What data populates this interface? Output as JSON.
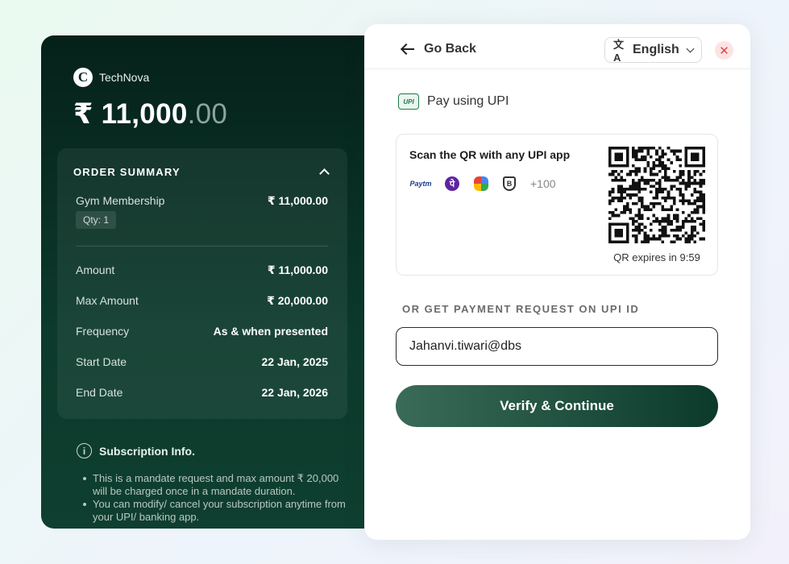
{
  "merchant": {
    "logo_letter": "C",
    "name": "TechNova"
  },
  "total": {
    "main": "₹ 11,000",
    "decimals": ".00"
  },
  "order_summary": {
    "title": "ORDER SUMMARY",
    "item": {
      "name": "Gym Membership",
      "price": "₹ 11,000.00",
      "qty": "Qty: 1"
    },
    "details": [
      {
        "label": "Amount",
        "value": "₹ 11,000.00"
      },
      {
        "label": "Max Amount",
        "value": "₹ 20,000.00"
      },
      {
        "label": "Frequency",
        "value": "As & when presented"
      },
      {
        "label": "Start Date",
        "value": "22 Jan, 2025"
      },
      {
        "label": "End Date",
        "value": "22 Jan, 2026"
      }
    ]
  },
  "subscription_info": {
    "icon": "info-icon",
    "title": "Subscription Info.",
    "bullets": [
      "This is a mandate request and max amount ₹ 20,000 will be charged once in a mandate duration.",
      "You can modify/ cancel your subscription anytime from your UPI/ banking app."
    ]
  },
  "topbar": {
    "back_label": "Go Back",
    "language": {
      "icon": "文A",
      "label": "English"
    },
    "close_symbol": "✕"
  },
  "upi": {
    "icon_text": "UPI",
    "title": "Pay using UPI",
    "scan_text": "Scan the QR with any UPI app",
    "apps": {
      "paytm": "Paytm",
      "phonepe": "पे",
      "bhim": "B",
      "more": "+100"
    },
    "qr_expiry": "QR expires in 9:59",
    "or_label": "OR GET PAYMENT REQUEST ON UPI ID",
    "input_value": "Jahanvi.tiwari@dbs",
    "verify_label": "Verify & Continue"
  },
  "colors": {
    "left_panel": "#05211a",
    "button_start": "#3a6b58",
    "button_end": "#0b3a2a",
    "close_bg": "#fde3e3",
    "close_fg": "#e04848"
  }
}
